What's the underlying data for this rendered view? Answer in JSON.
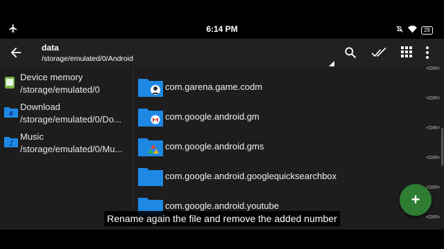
{
  "status": {
    "time": "6:14 PM",
    "battery": "29"
  },
  "toolbar": {
    "title": "data",
    "path": "/storage/emulated/0/Android"
  },
  "sidebar": {
    "items": [
      {
        "name": "Device memory",
        "path": "/storage/emulated/0",
        "icon": "device-memory-icon"
      },
      {
        "name": "Download",
        "path": "/storage/emulated/0/Do...",
        "icon": "download-folder-icon"
      },
      {
        "name": "Music",
        "path": "/storage/emulated/0/Mu...",
        "icon": "music-folder-icon"
      }
    ]
  },
  "files": [
    {
      "name": "com.garena.game.codm",
      "tag": "<DIR>"
    },
    {
      "name": "com.google.android.gm",
      "tag": "<DIR>"
    },
    {
      "name": "com.google.android.gms",
      "tag": "<DIR>"
    },
    {
      "name": "com.google.android.googlequicksearchbox",
      "tag": "<DIR>"
    },
    {
      "name": "com.google.android.youtube",
      "tag": "<DIR>"
    }
  ],
  "top_dir_tag": "<DIR>",
  "fab": {
    "label": "+"
  },
  "caption": "Rename again the file and remove the added number",
  "colors": {
    "folder": "#1e88e5",
    "fab": "#2e7d32",
    "toolbar": "#212121",
    "list_bg": "#1d1d1d"
  }
}
